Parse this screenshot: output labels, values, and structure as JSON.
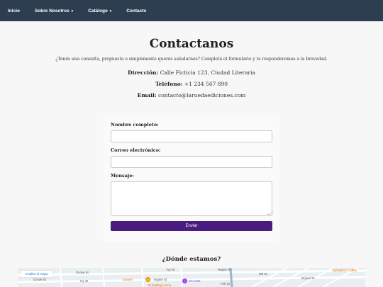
{
  "nav": {
    "items": [
      {
        "label": "Inicio",
        "caret": ""
      },
      {
        "label": "Sobre Nosotros",
        "caret": "▾"
      },
      {
        "label": "Catálogo",
        "caret": "▾"
      },
      {
        "label": "Contacto",
        "caret": ""
      }
    ],
    "bg_color": "#2c3e50"
  },
  "page": {
    "title": "Contactanos",
    "intro": "¿Tenés una consulta, propuesta o simplemente querés saludarnos? Completá el formulario y te responderemos a la brevedad."
  },
  "contact_info": {
    "address_label": "Dirección:",
    "address_value": "Calle Ficticia 123, Ciudad Literaria",
    "phone_label": "Teléfono:",
    "phone_value": "+1 234 567 890",
    "email_label": "Email:",
    "email_value": "contacto@laruedaediciones.com"
  },
  "form": {
    "name_label": "Nombre completo:",
    "name_value": "",
    "email_label": "Correo electrónico:",
    "email_value": "",
    "message_label": "Mensaje:",
    "message_value": "",
    "submit_label": "Enviar",
    "submit_color": "#4b1b80"
  },
  "map": {
    "title": "¿Dónde estamos?",
    "enlarge_label": "Ampliar el mapa",
    "labels": [
      "Grove St",
      "Grove St",
      "Ivy St",
      "Ivy St",
      "Hayes St",
      "Hayes St",
      "Fell St",
      "SFJAZZ",
      "Souvla",
      "Dumpling Home",
      "Sightglass Coffee",
      "9th St",
      "Bryant St"
    ]
  }
}
